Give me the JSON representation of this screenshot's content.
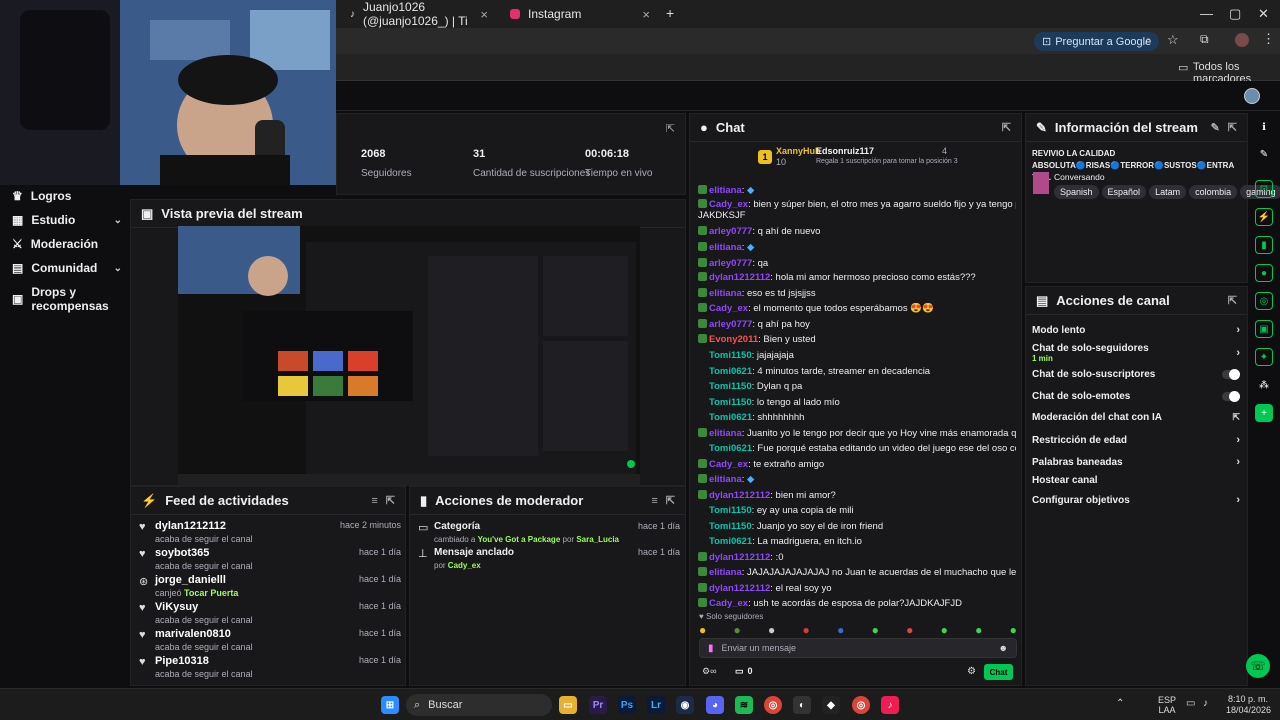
{
  "browser": {
    "tabs": [
      {
        "label": "Juanjo1026 (@juanjo1026_) | Ti"
      },
      {
        "label": "Instagram"
      }
    ],
    "new_tab": "+",
    "ask_google": "Preguntar a Google",
    "bookmarks_all": "Todos los marcadores"
  },
  "sidebar": {
    "items": [
      {
        "label": "Logros"
      },
      {
        "label": "Estudio"
      },
      {
        "label": "Moderación"
      },
      {
        "label": "Comunidad"
      },
      {
        "label": "Drops y recompensas"
      }
    ]
  },
  "stats": {
    "followers_value": "2068",
    "followers_label": "Seguidores",
    "subs_value": "31",
    "subs_label": "Cantidad de suscripciones",
    "live_value": "00:06:18",
    "live_label": "Tiempo en vivo"
  },
  "preview": {
    "title": "Vista previa del stream"
  },
  "feed": {
    "title": "Feed de actividades",
    "items": [
      {
        "name": "dylan1212112",
        "sub": "acaba de seguir el canal",
        "time": "hace 2 minutos",
        "icon": "heart-icon"
      },
      {
        "name": "soybot365",
        "sub": "acaba de seguir el canal",
        "time": "hace 1 día",
        "icon": "heart-icon"
      },
      {
        "name": "jorge_danielll",
        "sub": "canjeó",
        "sub_highlight": "Tocar Puerta",
        "time": "hace 1 día",
        "icon": "points-icon"
      },
      {
        "name": "ViKysuy",
        "sub": "acaba de seguir el canal",
        "time": "hace 1 día",
        "icon": "heart-icon"
      },
      {
        "name": "marivalen0810",
        "sub": "acaba de seguir el canal",
        "time": "hace 1 día",
        "icon": "heart-icon"
      },
      {
        "name": "Pipe10318",
        "sub": "acaba de seguir el canal",
        "time": "hace 1 día",
        "icon": "heart-icon"
      }
    ]
  },
  "modactions": {
    "title": "Acciones de moderador",
    "items": [
      {
        "title": "Categoría",
        "pre": "cambiado a",
        "highlight": "You've Got a Package",
        "mid": "por",
        "user": "Sara_Lucia",
        "time": "hace 1 día"
      },
      {
        "title": "Mensaje anclado",
        "pre": "",
        "highlight": "",
        "mid": "por",
        "user": "Cady_ex",
        "time": "hace 1 día"
      }
    ]
  },
  "chat": {
    "title": "Chat",
    "top_user1": "XannyHub",
    "top_user1_count": "10",
    "top_user2": "Edsonruiz117",
    "top_user2_count": "4",
    "top_caption": "Regala 1 suscripción para tomar la posición 3",
    "messages": [
      {
        "user": "elitiana",
        "color": "#9147ff",
        "text": ":",
        "emote": true
      },
      {
        "user": "Cady_ex",
        "color": "#9147ff",
        "text": ": bien y súper bien, el otro mes ya agarro sueldo fijo y ya tengo para la sub 🙏🙏🙏"
      },
      {
        "user": "",
        "color": "#efeff1",
        "text": "JAKDKSJF"
      },
      {
        "user": "arley0777",
        "color": "#9147ff",
        "text": ": q ahí de nuevo"
      },
      {
        "user": "elitiana",
        "color": "#9147ff",
        "text": ":",
        "emote": true
      },
      {
        "user": "arley0777",
        "color": "#9147ff",
        "text": ": qa"
      },
      {
        "user": "dylan1212112",
        "color": "#9147ff",
        "text": ": hola mi amor hermoso precioso como estás???"
      },
      {
        "user": "elitiana",
        "color": "#9147ff",
        "text": ": eso es td jsjsjjss"
      },
      {
        "user": "Cady_ex",
        "color": "#9147ff",
        "text": ": el momento que todos esperábamos 😍😍"
      },
      {
        "user": "arley0777",
        "color": "#9147ff",
        "text": ": q ahí pa hoy"
      },
      {
        "user": "Evony2011",
        "color": "#ff4f4f",
        "text": ": Bien y usted"
      },
      {
        "user": "Tomi1150",
        "color": "#00c8af",
        "text": ": jajajajaja"
      },
      {
        "user": "Tomi0621",
        "color": "#00c8af",
        "text": ": 4 minutos tarde, streamer en decadencia"
      },
      {
        "user": "Tomi1150",
        "color": "#00c8af",
        "text": ": Dylan q pa"
      },
      {
        "user": "Tomi1150",
        "color": "#00c8af",
        "text": ": lo tengo al lado mío"
      },
      {
        "user": "Tomi0621",
        "color": "#00c8af",
        "text": ": shhhhhhhh"
      },
      {
        "user": "elitiana",
        "color": "#9147ff",
        "text": ": Juanito yo le tengo por decir que yo Hoy vine más enamorada que 20"
      },
      {
        "user": "Tomi0621",
        "color": "#00c8af",
        "text": ": Fue porqué estaba editando un video del juego ese del oso con el pastel"
      },
      {
        "user": "Cady_ex",
        "color": "#9147ff",
        "text": ": te extraño amigo"
      },
      {
        "user": "elitiana",
        "color": "#9147ff",
        "text": ":",
        "emote": true
      },
      {
        "user": "dylan1212112",
        "color": "#9147ff",
        "text": ": bien mi amor?"
      },
      {
        "user": "Tomi1150",
        "color": "#00c8af",
        "text": ": ey ay una copia de mili"
      },
      {
        "user": "Tomi1150",
        "color": "#00c8af",
        "text": ": Juanjo yo soy el de iron friend"
      },
      {
        "user": "Tomi0621",
        "color": "#00c8af",
        "text": ": La madriguera, en itch.io"
      },
      {
        "user": "dylan1212112",
        "color": "#9147ff",
        "text": ": :0"
      },
      {
        "user": "elitiana",
        "color": "#9147ff",
        "text": ": JAJAJAJAJAJAJAJ no Juan te acuerdas de el muchacho que le conté"
      },
      {
        "user": "dylan1212112",
        "color": "#9147ff",
        "text": ": el real soy yo"
      },
      {
        "user": "Cady_ex",
        "color": "#9147ff",
        "text": ": ush te acordás de esposa de polar?JAJDKAJFJD"
      }
    ],
    "followers_only": "Solo seguidores",
    "input_placeholder": "Enviar un mensaje",
    "points": "0",
    "send": "Chat"
  },
  "info": {
    "title": "Información del stream",
    "stream_title": "REVIVIO LA CALIDAD ABSOLUTA🔵RISAS🔵TERROR🔵SUSTOS🔵ENTRA YA ...",
    "category": "Conversando",
    "tags": [
      "Spanish",
      "Español",
      "Latam",
      "colombia",
      "gaming"
    ]
  },
  "actions": {
    "title": "Acciones de canal",
    "items": [
      {
        "label": "Modo lento",
        "kind": "chevron"
      },
      {
        "label": "Chat de solo-seguidores",
        "sub": "1 min",
        "kind": "chevron"
      },
      {
        "label": "Chat de solo-suscriptores",
        "kind": "toggle"
      },
      {
        "label": "Chat de solo-emotes",
        "kind": "toggle"
      },
      {
        "label": "Moderación del chat con IA",
        "kind": "ext"
      },
      {
        "label": "Restricción de edad",
        "kind": "chevron"
      },
      {
        "label": "Palabras baneadas",
        "kind": "chevron"
      },
      {
        "label": "Hostear canal",
        "kind": "none"
      },
      {
        "label": "Configurar objetivos",
        "kind": "chevron"
      }
    ]
  },
  "taskbar": {
    "search": "Buscar",
    "lang1": "ESP",
    "lang2": "LAA",
    "time": "8:10 p. m.",
    "date": "18/04/2026"
  },
  "colors": {
    "accent": "#9147ff",
    "green": "#00c853",
    "bg": "#0e0e10",
    "panel": "#18181b"
  }
}
